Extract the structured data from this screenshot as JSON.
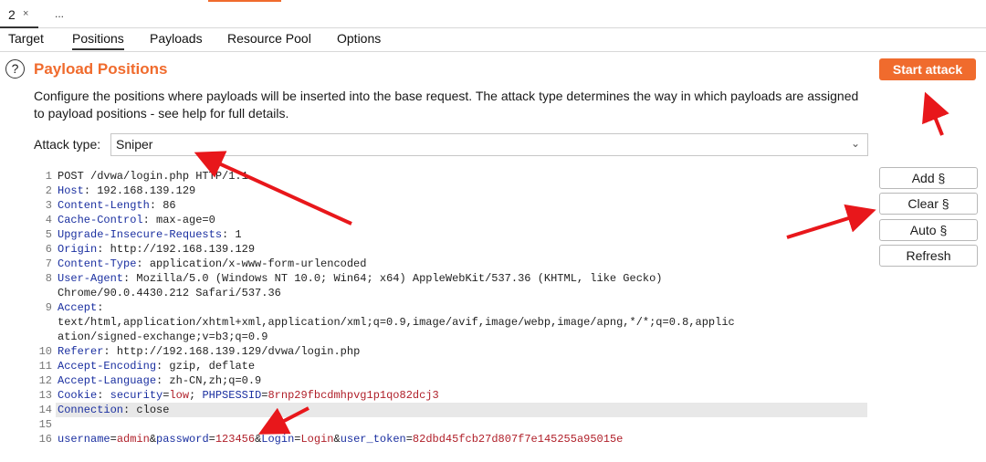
{
  "tabs": {
    "number": "2",
    "close": "×",
    "more": "..."
  },
  "subtabs": [
    "Target",
    "Positions",
    "Payloads",
    "Resource Pool",
    "Options"
  ],
  "section": {
    "help": "?",
    "title": "Payload Positions",
    "description": "Configure the positions where payloads will be inserted into the base request. The attack type determines the way in which payloads are assigned to payload positions - see help for full details.",
    "start_attack": "Start attack"
  },
  "attack_type": {
    "label": "Attack type:",
    "value": "Sniper"
  },
  "buttons": {
    "add": "Add §",
    "clear": "Clear §",
    "auto": "Auto §",
    "refresh": "Refresh"
  },
  "request": {
    "line_numbers": [
      "1",
      "2",
      "3",
      "4",
      "5",
      "6",
      "7",
      "8",
      "",
      "9",
      "",
      "",
      "10",
      "11",
      "12",
      "13",
      "14",
      "15",
      "16"
    ],
    "lines": [
      [
        {
          "t": "POST /dvwa/login.php HTTP/1.1"
        }
      ],
      [
        {
          "t": "Host",
          "c": "k"
        },
        {
          "t": ": 192.168.139.129"
        }
      ],
      [
        {
          "t": "Content-Length",
          "c": "k"
        },
        {
          "t": ": 86"
        }
      ],
      [
        {
          "t": "Cache-Control",
          "c": "k"
        },
        {
          "t": ": max-age=0"
        }
      ],
      [
        {
          "t": "Upgrade-Insecure-Requests",
          "c": "k"
        },
        {
          "t": ": 1"
        }
      ],
      [
        {
          "t": "Origin",
          "c": "k"
        },
        {
          "t": ": http://192.168.139.129"
        }
      ],
      [
        {
          "t": "Content-Type",
          "c": "k"
        },
        {
          "t": ": application/x-www-form-urlencoded"
        }
      ],
      [
        {
          "t": "User-Agent",
          "c": "k"
        },
        {
          "t": ": Mozilla/5.0 (Windows NT 10.0; Win64; x64) AppleWebKit/537.36 (KHTML, like Gecko)"
        }
      ],
      [
        {
          "t": "Chrome/90.0.4430.212 Safari/537.36"
        }
      ],
      [
        {
          "t": "Accept",
          "c": "k"
        },
        {
          "t": ":"
        }
      ],
      [
        {
          "t": "text/html,application/xhtml+xml,application/xml;q=0.9,image/avif,image/webp,image/apng,*/*;q=0.8,applic"
        }
      ],
      [
        {
          "t": "ation/signed-exchange;v=b3;q=0.9"
        }
      ],
      [
        {
          "t": "Referer",
          "c": "k"
        },
        {
          "t": ": http://192.168.139.129/dvwa/login.php"
        }
      ],
      [
        {
          "t": "Accept-Encoding",
          "c": "k"
        },
        {
          "t": ": gzip, deflate"
        }
      ],
      [
        {
          "t": "Accept-Language",
          "c": "k"
        },
        {
          "t": ": zh-CN,zh;q=0.9"
        }
      ],
      [
        {
          "t": "Cookie",
          "c": "k"
        },
        {
          "t": ": "
        },
        {
          "t": "security",
          "c": "k"
        },
        {
          "t": "="
        },
        {
          "t": "low",
          "c": "r"
        },
        {
          "t": "; "
        },
        {
          "t": "PHPSESSID",
          "c": "k"
        },
        {
          "t": "="
        },
        {
          "t": "8rnp29fbcdmhpvg1p1qo82dcj3",
          "c": "r"
        }
      ],
      [
        {
          "t": "Connection",
          "c": "k"
        },
        {
          "t": ": close"
        }
      ],
      [
        {
          "t": ""
        }
      ],
      [
        {
          "t": "username",
          "c": "k"
        },
        {
          "t": "="
        },
        {
          "t": "admin",
          "c": "r"
        },
        {
          "t": "&"
        },
        {
          "t": "password",
          "c": "k"
        },
        {
          "t": "="
        },
        {
          "t": "123456",
          "c": "r"
        },
        {
          "t": "&"
        },
        {
          "t": "Login",
          "c": "k"
        },
        {
          "t": "="
        },
        {
          "t": "Login",
          "c": "r"
        },
        {
          "t": "&"
        },
        {
          "t": "user_token",
          "c": "k"
        },
        {
          "t": "="
        },
        {
          "t": "82dbd45fcb27d807f7e145255a95015e",
          "c": "r"
        }
      ]
    ],
    "highlighted_line": "14"
  },
  "colors": {
    "accent": "#f06b2d",
    "annotation_arrow": "#e8171b",
    "header_name": "#1a2fa0",
    "value_red": "#b0202a"
  }
}
